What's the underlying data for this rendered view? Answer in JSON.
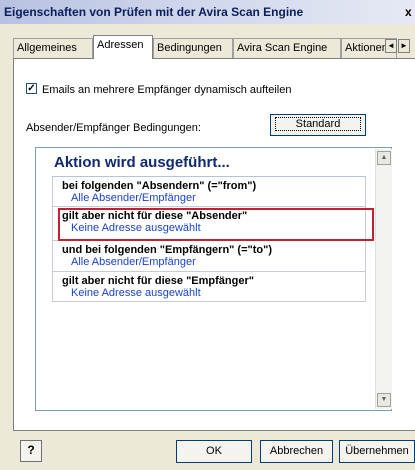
{
  "window": {
    "title": "Eigenschaften von Prüfen mit der Avira Scan Engine",
    "close_glyph": "x"
  },
  "tabs": [
    {
      "label": "Allgemeines"
    },
    {
      "label": "Adressen"
    },
    {
      "label": "Bedingungen"
    },
    {
      "label": "Avira Scan Engine"
    },
    {
      "label": "Aktionen"
    }
  ],
  "tab_scroll": {
    "left": "◄",
    "right": "►"
  },
  "checkbox": {
    "label": "Emails an mehrere Empfänger dynamisch aufteilen",
    "checked": true,
    "mark": "✓"
  },
  "conditions_label": "Absender/Empfänger Bedingungen:",
  "standard_button": "Standard",
  "list": {
    "heading": "Aktion wird ausgeführt...",
    "conditions": [
      {
        "title": "bei folgenden \"Absendern\" (=\"from\")",
        "value": "Alle Absender/Empfänger"
      },
      {
        "title": "gilt aber nicht für diese \"Absender\"",
        "value": "Keine Adresse ausgewählt",
        "highlighted": true
      },
      {
        "title": "und bei folgenden \"Empfängern\" (=\"to\")",
        "value": "Alle Absender/Empfänger"
      },
      {
        "title": "gilt aber nicht für diese \"Empfänger\"",
        "value": "Keine Adresse ausgewählt"
      }
    ],
    "scroll_up": "▲",
    "scroll_down": "▼"
  },
  "footer": {
    "help_glyph": "?",
    "ok": "OK",
    "cancel": "Abbrechen",
    "apply": "Übernehmen"
  },
  "colors": {
    "highlight_border": "#c42030",
    "link_text": "#1a44c7",
    "heading": "#102a70"
  }
}
